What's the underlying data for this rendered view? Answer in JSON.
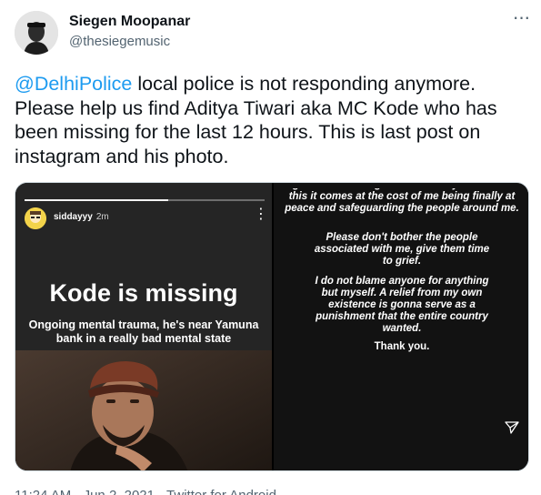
{
  "author": {
    "display_name": "Siegen Moopanar",
    "handle": "@thesiegemusic",
    "more_icon": "ellipsis-icon"
  },
  "tweet": {
    "mention": "@DelhiPolice",
    "text": " local police is not responding anymore. Please help us find Aditya Tiwari aka MC Kode who has been missing for the last 12 hours. This is last post on instagram and his photo."
  },
  "story_left": {
    "username": "siddayyy",
    "time": "2m",
    "progress": 0.6,
    "headline": "Kode is missing",
    "subtext": "Ongoing mental trauma, he's near Yamuna bank in a really bad mental state"
  },
  "story_right": {
    "lines_1": "a great amount of grief but I need you to realize this it comes at the cost of me being finally at peace and safeguarding the people around me.",
    "lines_2": "Please don't bother the people associated with me, give them time to grief.",
    "lines_3": "I do not blame anyone for anything but myself. A relief from my own existence is gonna serve as a punishment that the entire country wanted.",
    "lines_4": "Thank you.",
    "send_icon": "send-icon"
  },
  "footer": {
    "meta": "11:24 AM · Jun 2, 2021 · Twitter for Android"
  }
}
